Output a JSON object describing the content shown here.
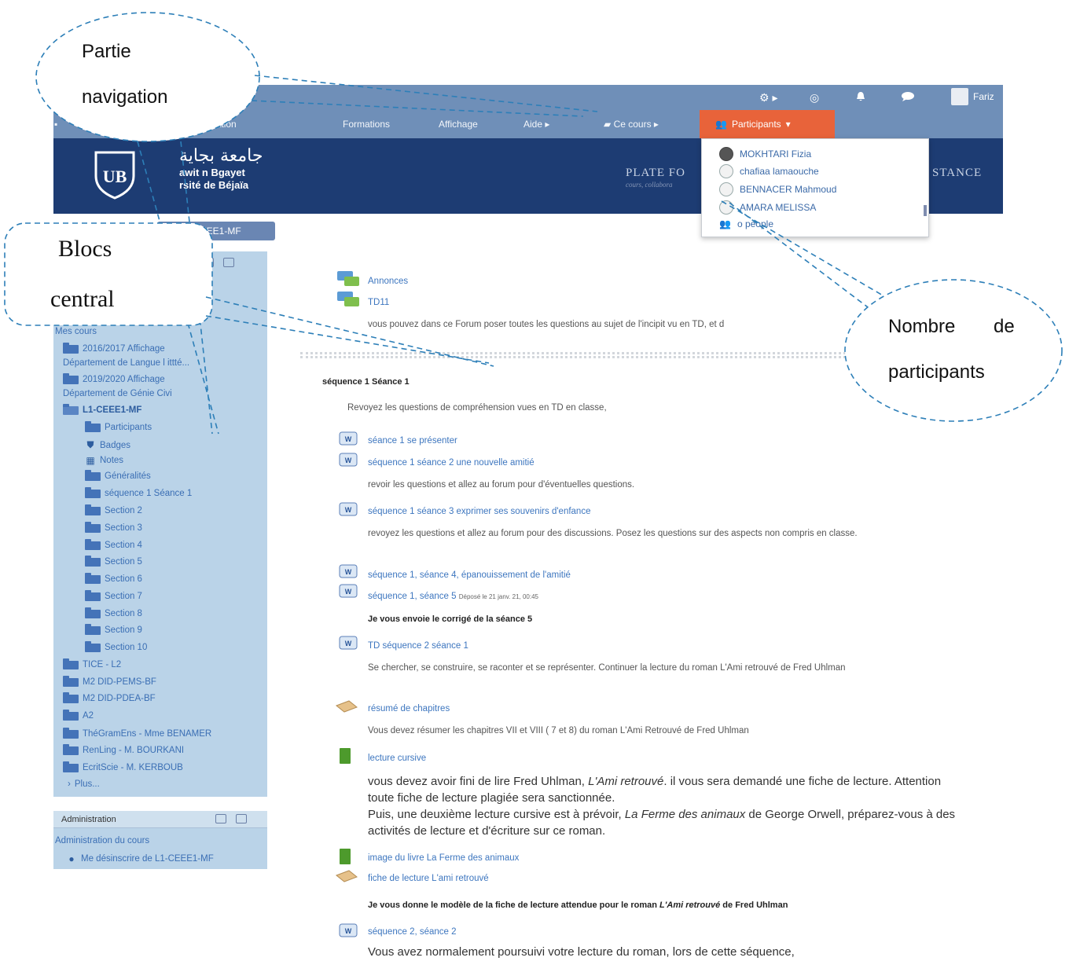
{
  "top_bar": {
    "icons": [
      "gear-icon",
      "help-icon",
      "bell-icon",
      "chat-icon"
    ],
    "user_name": "Fariz"
  },
  "nav": {
    "items": [
      "Collaboration",
      "Formations",
      "Affichage",
      "Aide ▸",
      "Ce cours ▸"
    ],
    "participants_label": "Participants"
  },
  "banner": {
    "arabic": "جامعة بجاية",
    "line1": "awit n Bgayet",
    "line2": "rsité de Béjaïa",
    "plateforme": "PLATE FO",
    "plateforme_sub": "cours, collabora",
    "distance": "STANCE"
  },
  "participants_dropdown": {
    "items": [
      "MOKHTARI Fizia",
      "chafiaa lamaouche",
      "BENNACER Mahmoud",
      "AMARA MELISSA"
    ],
    "more": "o people"
  },
  "sidebar": {
    "course_tab": "CEEE1-MF",
    "mes_cours": "Mes cours",
    "entries": [
      {
        "label": "2016/2017 Affichage",
        "icon": "folder-icon"
      },
      {
        "label": "Département de Langue l ittté...",
        "icon": ""
      },
      {
        "label": "2019/2020 Affichage",
        "icon": "folder-icon"
      },
      {
        "label": "Département de Génie Civi",
        "icon": ""
      },
      {
        "label": "L1-CEEE1-MF",
        "icon": "folder-open-icon"
      },
      {
        "label": "Participants",
        "icon": "folder-icon"
      },
      {
        "label": "Badges",
        "icon": "badge-icon"
      },
      {
        "label": "Notes",
        "icon": "table-icon"
      },
      {
        "label": "Généralités",
        "icon": "folder-icon"
      },
      {
        "label": "séquence 1 Séance 1",
        "icon": "folder-icon"
      },
      {
        "label": "Section 2",
        "icon": "folder-icon"
      },
      {
        "label": "Section 3",
        "icon": "folder-icon"
      },
      {
        "label": "Section 4",
        "icon": "folder-icon"
      },
      {
        "label": "Section 5",
        "icon": "folder-icon"
      },
      {
        "label": "Section 6",
        "icon": "folder-icon"
      },
      {
        "label": "Section 7",
        "icon": "folder-icon"
      },
      {
        "label": "Section 8",
        "icon": "folder-icon"
      },
      {
        "label": "Section 9",
        "icon": "folder-icon"
      },
      {
        "label": "Section 10",
        "icon": "folder-icon"
      },
      {
        "label": "TICE - L2",
        "icon": "folder-icon"
      },
      {
        "label": "M2 DID-PEMS-BF",
        "icon": "folder-icon"
      },
      {
        "label": "M2 DID-PDEA-BF",
        "icon": "folder-icon"
      },
      {
        "label": "A2",
        "icon": "folder-icon"
      },
      {
        "label": "ThéGramEns - Mme BENAMER",
        "icon": "folder-icon"
      },
      {
        "label": "RenLing - M. BOURKANI",
        "icon": "folder-icon"
      },
      {
        "label": "EcritScie - M. KERBOUB",
        "icon": "folder-icon"
      },
      {
        "label": "Plus...",
        "icon": "chevron-right-icon"
      }
    ],
    "admin_title": "Administration",
    "admin_items": [
      "Administration du cours",
      "Me désinscrire de L1-CEEE1-MF"
    ]
  },
  "main": {
    "annonces": "Annonces",
    "td11": "TD11",
    "td11_desc": "vous pouvez dans ce Forum poser toutes les questions au sujet de l'incipit vu en TD, et d",
    "section_title": "séquence 1 Séance 1",
    "section_summary": "Revoyez les questions de compréhension vues en TD en classe,",
    "activities": {
      "a1": "séance 1 se présenter",
      "a2": "séquence 1 séance 2 une nouvelle amitié",
      "a2_desc": "revoir les questions et allez au forum pour d'éventuelles questions.",
      "a3": "séquence 1 séance 3 exprimer ses souvenirs d'enfance",
      "a3_desc": "revoyez les questions et allez au forum pour des discussions. Posez les questions sur des aspects non compris en classe.",
      "a4": "séquence 1, séance 4, épanouissement de l'amitié",
      "a5": "séquence 1, séance 5",
      "a5_note": "Déposé le 21 janv. 21, 00:45",
      "a5_desc": "Je vous envoie le corrigé de la séance 5",
      "a6": "TD séquence 2 séance 1",
      "a6_desc": "Se chercher, se construire, se raconter et se représenter. Continuer la lecture du roman L'Ami retrouvé de Fred Uhlman",
      "a7": "résumé de chapitres",
      "a7_desc": "Vous devez résumer les chapitres VII et VIII ( 7 et 8) du roman L'Ami Retrouvé de Fred Uhlman",
      "a8": "lecture cursive",
      "a8_desc_1a": "vous devez avoir fini de lire Fred Uhlman, ",
      "a8_desc_1b": "L'Ami retrouvé",
      "a8_desc_1c": ". il vous sera demandé une fiche de lecture. Attention toute fiche de lecture plagiée sera sanctionnée.",
      "a8_desc_2a": "Puis, une deuxième lecture cursive est à prévoir, ",
      "a8_desc_2b": "La Ferme des animaux",
      "a8_desc_2c": " de George Orwell, préparez-vous à des activités de lecture et d'écriture sur ce roman.",
      "a9": "image du livre La Ferme des animaux",
      "a10": "fiche de lecture L'ami retrouvé",
      "a10_desc_a": "Je vous donne le modèle de la fiche de lecture attendue pour le roman ",
      "a10_desc_b": "L'Ami retrouvé",
      "a10_desc_c": " de Fred Uhlman",
      "a11": "séquence 2, séance 2",
      "a11_desc": "Vous avez normalement poursuivi votre lecture du roman, lors de cette séquence,"
    }
  },
  "callouts": {
    "navigation_1": "Partie",
    "navigation_2": "navigation",
    "blocs_1": "Blocs",
    "blocs_2": "central",
    "participants_1": "Nombre",
    "participants_de": "de",
    "participants_2": "participants"
  }
}
